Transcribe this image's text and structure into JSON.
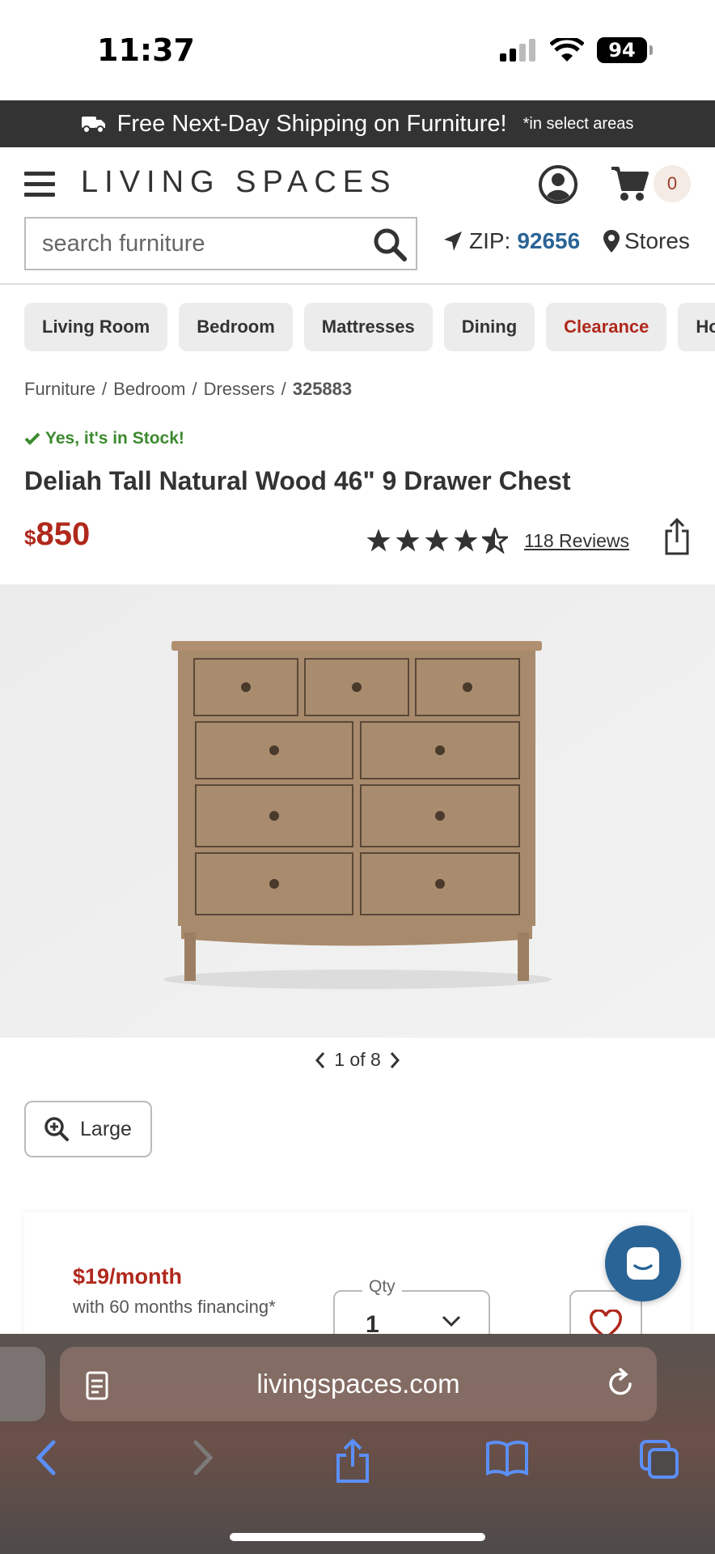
{
  "status": {
    "time": "11:37",
    "battery": "94"
  },
  "promo": {
    "text": "Free Next-Day Shipping on Furniture!",
    "note": "*in select areas"
  },
  "header": {
    "logo": "LIVING SPACES",
    "cart_count": "0",
    "search_placeholder": "search furniture",
    "zip_label": "ZIP:",
    "zip_value": "92656",
    "stores_label": "Stores"
  },
  "categories": [
    "Living Room",
    "Bedroom",
    "Mattresses",
    "Dining",
    "Clearance",
    "Hor"
  ],
  "breadcrumb": {
    "items": [
      "Furniture",
      "Bedroom",
      "Dressers"
    ],
    "current": "325883",
    "separator": "/"
  },
  "product": {
    "stock": "Yes, it's in Stock!",
    "title": "Deliah Tall Natural Wood 46\" 9 Drawer Chest",
    "currency": "$",
    "price": "850",
    "rating": 4.5,
    "reviews": "118 Reviews",
    "image_pager": "1 of 8",
    "large_label": "Large"
  },
  "financing": {
    "monthly": "$19/month",
    "note": "with 60 months financing*"
  },
  "quantity": {
    "label": "Qty",
    "value": "1"
  },
  "browser": {
    "url": "livingspaces.com"
  },
  "colors": {
    "brand_red": "#b0281c",
    "link_blue": "#2a6496",
    "stock_green": "#3c8a2e",
    "promo_bg": "#333333"
  }
}
